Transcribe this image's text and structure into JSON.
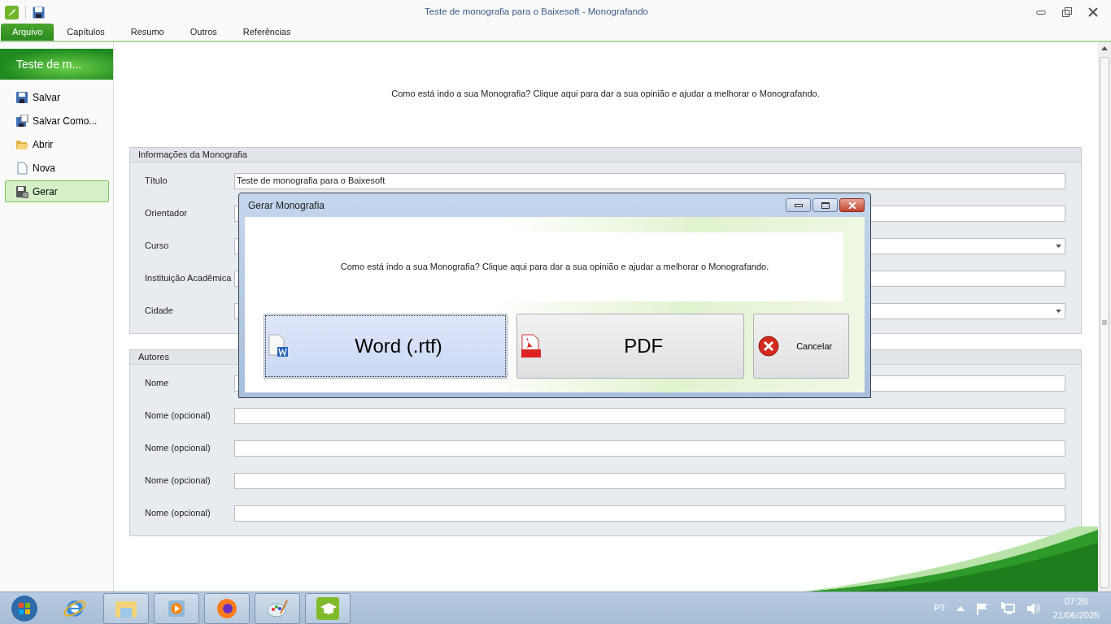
{
  "window": {
    "title": "Teste de monografia para o Baixesoft - Monografando"
  },
  "tabs": [
    {
      "label": "Arquivo",
      "selected": true
    },
    {
      "label": "Capítulos",
      "selected": false
    },
    {
      "label": "Resumo",
      "selected": false
    },
    {
      "label": "Outros",
      "selected": false
    },
    {
      "label": "Referências",
      "selected": false
    }
  ],
  "sidebar": {
    "header": "Teste de m...",
    "items": [
      {
        "label": "Salvar",
        "kind": "save",
        "selected": false
      },
      {
        "label": "Salvar Como...",
        "kind": "saveas",
        "selected": false
      },
      {
        "label": "Abrir",
        "kind": "open",
        "selected": false
      },
      {
        "label": "Nova",
        "kind": "new",
        "selected": false
      },
      {
        "label": "Gerar",
        "kind": "generate",
        "selected": true
      }
    ]
  },
  "feedback_link": "Como está indo a sua Monografia? Clique aqui para dar a sua opinião e ajudar a melhorar o Monografando.",
  "groups": [
    {
      "title": "Informações da Monografia",
      "fields": [
        {
          "label": "Título",
          "kind": "text",
          "value": "Teste de monografia para o Baixesoft"
        },
        {
          "label": "Orientador",
          "kind": "text"
        },
        {
          "label": "Curso",
          "kind": "combo"
        },
        {
          "label": "Instituição Acadêmica",
          "kind": "text"
        },
        {
          "label": "Cidade",
          "kind": "combo"
        }
      ]
    },
    {
      "title": "Autores",
      "fields": [
        {
          "label": "Nome",
          "kind": "text"
        },
        {
          "label": "Nome (opcional)",
          "kind": "text"
        },
        {
          "label": "Nome (opcional)",
          "kind": "text"
        },
        {
          "label": "Nome (opcional)",
          "kind": "text"
        },
        {
          "label": "Nome (opcional)",
          "kind": "text"
        }
      ]
    }
  ],
  "dialog": {
    "title": "Gerar Monografia",
    "message": "Como está indo a sua Monografia? Clique aqui para dar a sua opinião e ajudar a melhorar o Monografando.",
    "buttons": [
      {
        "label": "Word (.rtf)",
        "kind": "word",
        "focused": true
      },
      {
        "label": "PDF",
        "kind": "pdf",
        "focused": false
      },
      {
        "label": "Cancelar",
        "kind": "cancel",
        "focused": false
      }
    ]
  },
  "taskbar": {
    "language": "PT",
    "time": "07:26",
    "date": "21/06/2025"
  }
}
